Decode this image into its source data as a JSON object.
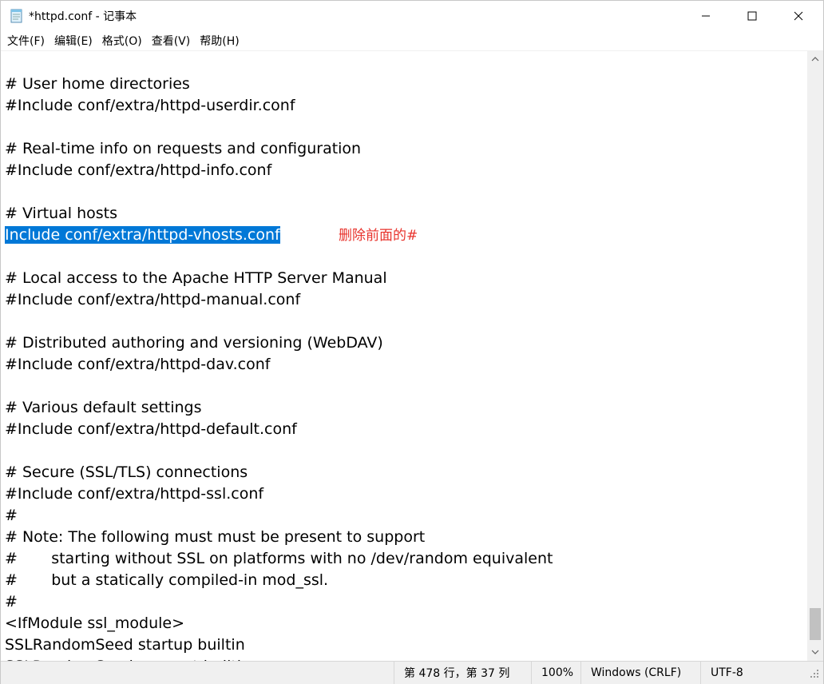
{
  "window": {
    "title": "*httpd.conf - 记事本",
    "icon": "notepad-icon"
  },
  "controls": {
    "minimize_icon": "minimize-icon",
    "maximize_icon": "maximize-icon",
    "close_icon": "close-icon"
  },
  "menu": {
    "items": [
      {
        "label": "文件(F)"
      },
      {
        "label": "编辑(E)"
      },
      {
        "label": "格式(O)"
      },
      {
        "label": "查看(V)"
      },
      {
        "label": "帮助(H)"
      }
    ]
  },
  "editor": {
    "lines": [
      {
        "text": "# User home directories"
      },
      {
        "text": "#Include conf/extra/httpd-userdir.conf"
      },
      {
        "text": ""
      },
      {
        "text": "# Real-time info on requests and configuration"
      },
      {
        "text": "#Include conf/extra/httpd-info.conf"
      },
      {
        "text": ""
      },
      {
        "text": "# Virtual hosts"
      },
      {
        "text": "Include conf/extra/httpd-vhosts.conf",
        "selected": true
      },
      {
        "text": ""
      },
      {
        "text": "# Local access to the Apache HTTP Server Manual"
      },
      {
        "text": "#Include conf/extra/httpd-manual.conf"
      },
      {
        "text": ""
      },
      {
        "text": "# Distributed authoring and versioning (WebDAV)"
      },
      {
        "text": "#Include conf/extra/httpd-dav.conf"
      },
      {
        "text": ""
      },
      {
        "text": "# Various default settings"
      },
      {
        "text": "#Include conf/extra/httpd-default.conf"
      },
      {
        "text": ""
      },
      {
        "text": "# Secure (SSL/TLS) connections"
      },
      {
        "text": "#Include conf/extra/httpd-ssl.conf"
      },
      {
        "text": "#"
      },
      {
        "text": "# Note: The following must must be present to support"
      },
      {
        "text": "#       starting without SSL on platforms with no /dev/random equivalent"
      },
      {
        "text": "#       but a statically compiled-in mod_ssl."
      },
      {
        "text": "#"
      },
      {
        "text": "<IfModule ssl_module>"
      },
      {
        "text": "SSLRandomSeed startup builtin"
      },
      {
        "text": "SSLRandomSeed connect builtin"
      }
    ],
    "annotation": "删除前面的#",
    "selection_color": "#0078d7",
    "annotation_color": "#e8332c"
  },
  "statusbar": {
    "position": "第 478 行，第 37 列",
    "zoom": "100%",
    "line_ending": "Windows (CRLF)",
    "encoding": "UTF-8"
  }
}
